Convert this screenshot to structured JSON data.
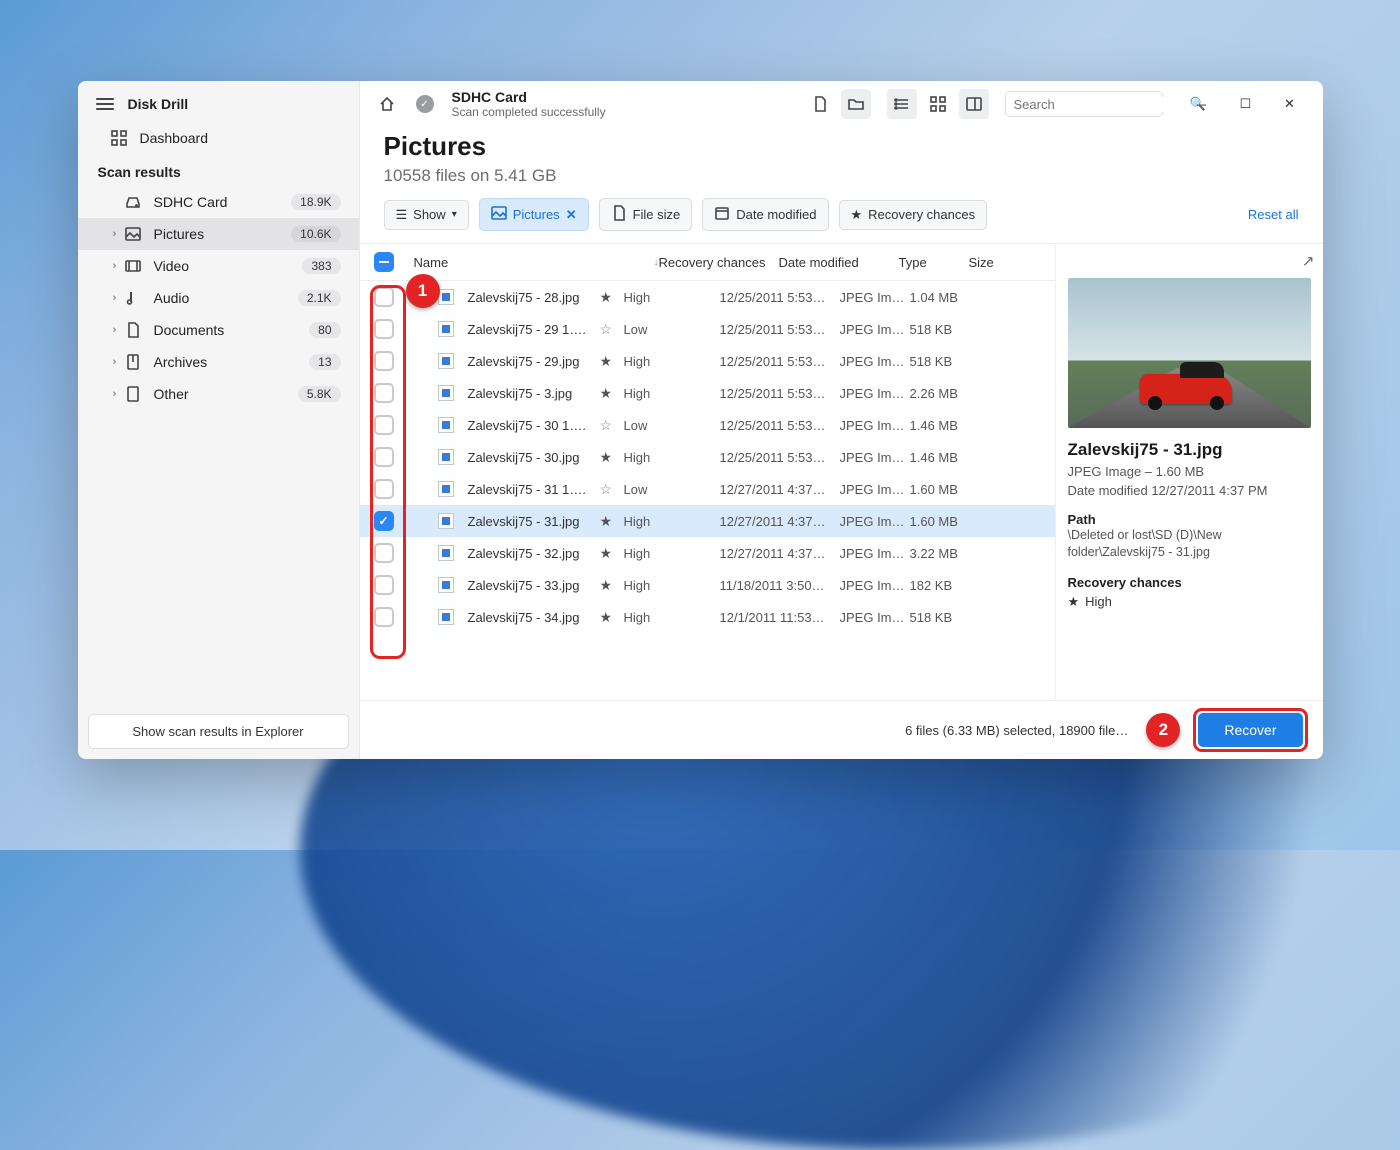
{
  "app": {
    "title": "Disk Drill"
  },
  "sidebar": {
    "dashboard": "Dashboard",
    "scan_results_label": "Scan results",
    "explorer_btn": "Show scan results in Explorer",
    "items": [
      {
        "label": "SDHC Card",
        "badge": "18.9K"
      },
      {
        "label": "Pictures",
        "badge": "10.6K"
      },
      {
        "label": "Video",
        "badge": "383"
      },
      {
        "label": "Audio",
        "badge": "2.1K"
      },
      {
        "label": "Documents",
        "badge": "80"
      },
      {
        "label": "Archives",
        "badge": "13"
      },
      {
        "label": "Other",
        "badge": "5.8K"
      }
    ]
  },
  "header": {
    "title": "SDHC Card",
    "subtitle": "Scan completed successfully",
    "search_placeholder": "Search"
  },
  "page": {
    "title": "Pictures",
    "subtitle": "10558 files on 5.41 GB"
  },
  "filters": {
    "show": "Show",
    "pictures": "Pictures",
    "file_size": "File size",
    "date_modified": "Date modified",
    "recovery": "Recovery chances",
    "reset": "Reset all"
  },
  "columns": {
    "name": "Name",
    "recovery": "Recovery chances",
    "date": "Date modified",
    "type": "Type",
    "size": "Size"
  },
  "rows": [
    {
      "name": "Zalevskij75 - 28.jpg",
      "rc": "High",
      "star": "solid",
      "date": "12/25/2011 5:53…",
      "type": "JPEG Im…",
      "size": "1.04 MB",
      "checked": false
    },
    {
      "name": "Zalevskij75 - 29 1….",
      "rc": "Low",
      "star": "hollow",
      "date": "12/25/2011 5:53…",
      "type": "JPEG Im…",
      "size": "518 KB",
      "checked": false
    },
    {
      "name": "Zalevskij75 - 29.jpg",
      "rc": "High",
      "star": "solid",
      "date": "12/25/2011 5:53…",
      "type": "JPEG Im…",
      "size": "518 KB",
      "checked": false
    },
    {
      "name": "Zalevskij75 - 3.jpg",
      "rc": "High",
      "star": "solid",
      "date": "12/25/2011 5:53…",
      "type": "JPEG Im…",
      "size": "2.26 MB",
      "checked": false
    },
    {
      "name": "Zalevskij75 - 30 1….",
      "rc": "Low",
      "star": "hollow",
      "date": "12/25/2011 5:53…",
      "type": "JPEG Im…",
      "size": "1.46 MB",
      "checked": false
    },
    {
      "name": "Zalevskij75 - 30.jpg",
      "rc": "High",
      "star": "solid",
      "date": "12/25/2011 5:53…",
      "type": "JPEG Im…",
      "size": "1.46 MB",
      "checked": false
    },
    {
      "name": "Zalevskij75 - 31 1….",
      "rc": "Low",
      "star": "hollow",
      "date": "12/27/2011 4:37…",
      "type": "JPEG Im…",
      "size": "1.60 MB",
      "checked": false
    },
    {
      "name": "Zalevskij75 - 31.jpg",
      "rc": "High",
      "star": "solid",
      "date": "12/27/2011 4:37…",
      "type": "JPEG Im…",
      "size": "1.60 MB",
      "checked": true,
      "selected": true
    },
    {
      "name": "Zalevskij75 - 32.jpg",
      "rc": "High",
      "star": "solid",
      "date": "12/27/2011 4:37…",
      "type": "JPEG Im…",
      "size": "3.22 MB",
      "checked": false
    },
    {
      "name": "Zalevskij75 - 33.jpg",
      "rc": "High",
      "star": "solid",
      "date": "11/18/2011 3:50…",
      "type": "JPEG Im…",
      "size": "182 KB",
      "checked": false
    },
    {
      "name": "Zalevskij75 - 34.jpg",
      "rc": "High",
      "star": "solid",
      "date": "12/1/2011 11:53…",
      "type": "JPEG Im…",
      "size": "518 KB",
      "checked": false
    }
  ],
  "preview": {
    "filename": "Zalevskij75 - 31.jpg",
    "meta": "JPEG Image – 1.60 MB",
    "modified": "Date modified 12/27/2011 4:37 PM",
    "path_label": "Path",
    "path": "\\Deleted or lost\\SD (D)\\New folder\\Zalevskij75 - 31.jpg",
    "rc_label": "Recovery chances",
    "rc_value": "High"
  },
  "footer": {
    "status": "6 files (6.33 MB) selected, 18900 file…",
    "recover": "Recover"
  },
  "annotations": {
    "one": "1",
    "two": "2"
  }
}
